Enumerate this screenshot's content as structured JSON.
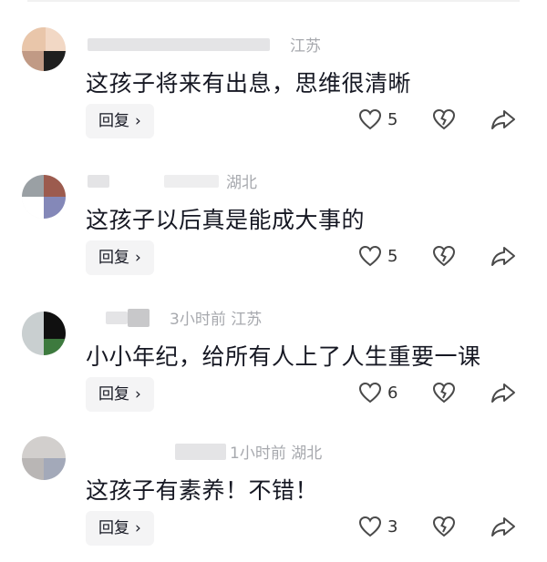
{
  "comments": [
    {
      "meta_text": "江苏",
      "content": "这孩子将来有出息，思维很清晰",
      "reply_label": "回复",
      "likes": "5",
      "avatar_colors": [
        "#e9c6aa",
        "#c19a85",
        "#1f1f1f",
        "#d9d9d9"
      ]
    },
    {
      "meta_text": "湖北",
      "content": "这孩子以后真是能成大事的",
      "reply_label": "回复",
      "likes": "5",
      "avatar_colors": [
        "#9aa0a4",
        "#9c5b4e",
        "#8488b8",
        "#ffffff"
      ]
    },
    {
      "meta_text": "3小时前  江苏",
      "content": "小小年纪，给所有人上了人生重要一课",
      "reply_label": "回复",
      "likes": "6",
      "avatar_colors": [
        "#c9cfd0",
        "#101010",
        "#3d7a3e",
        "#e6e6e6"
      ]
    },
    {
      "meta_text": "1小时前  湖北",
      "content": "这孩子有素养！不错！",
      "reply_label": "回复",
      "likes": "3",
      "avatar_colors": [
        "#d2cfcd",
        "#b9b6b5",
        "#a3a9b9",
        "#e3e1df"
      ]
    }
  ],
  "reply_arrow": "›",
  "icons": {
    "like": "heart-icon",
    "dislike": "broken-heart-icon",
    "share": "share-arrow-icon"
  }
}
